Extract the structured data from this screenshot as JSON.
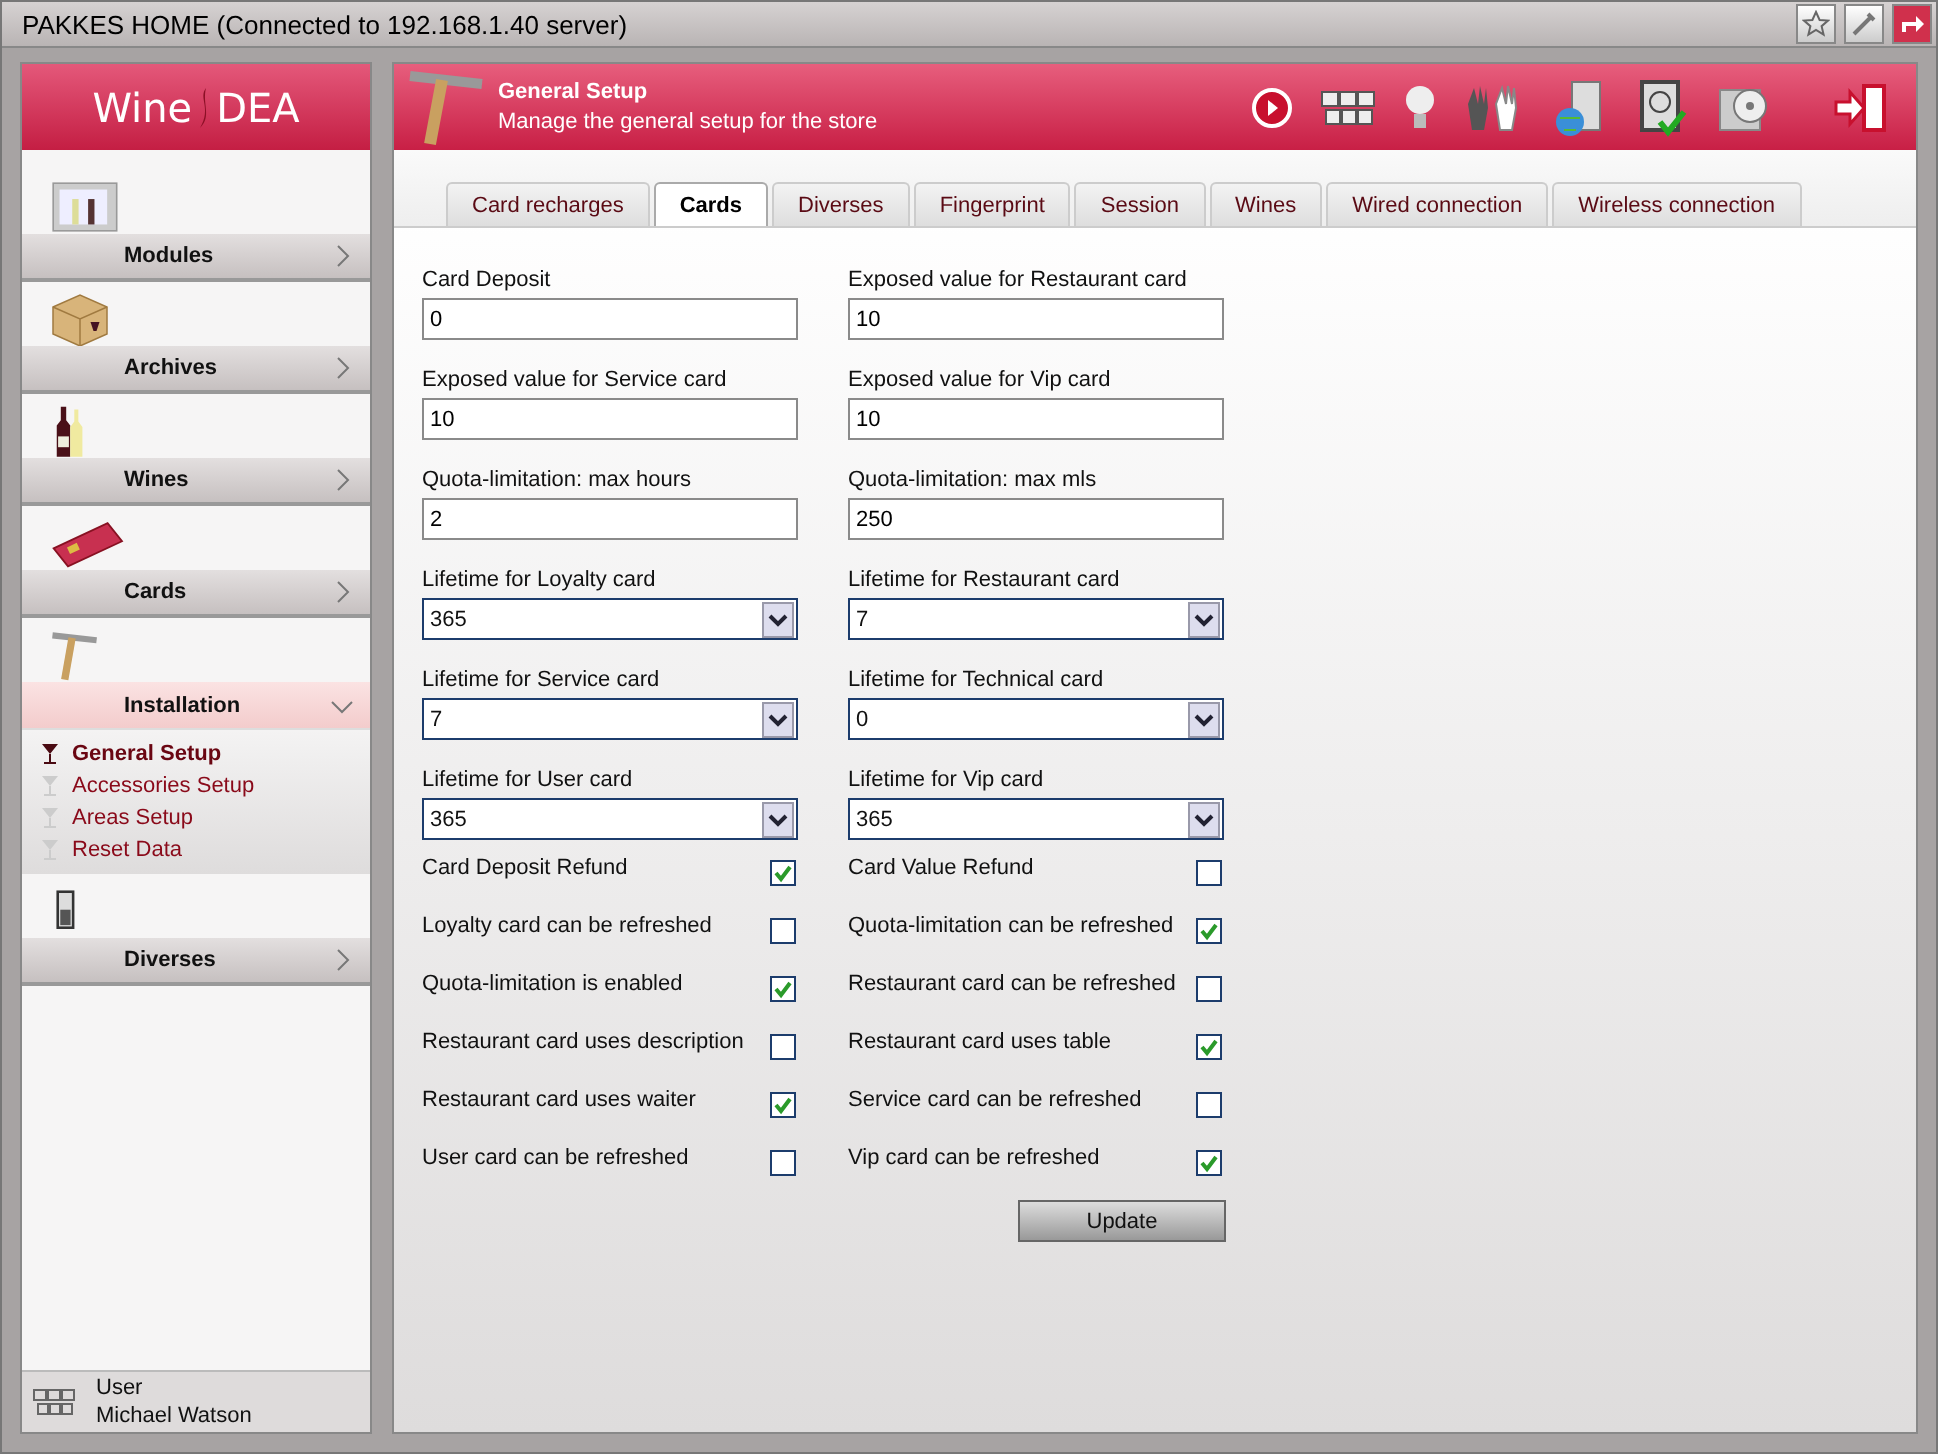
{
  "window": {
    "title": "PAKKES HOME (Connected to 192.168.1.40 server)"
  },
  "logo": {
    "left": "Wine",
    "right": "DEA"
  },
  "sidebar": {
    "items": [
      {
        "label": "Modules",
        "expanded": false
      },
      {
        "label": "Archives",
        "expanded": false
      },
      {
        "label": "Wines",
        "expanded": false
      },
      {
        "label": "Cards",
        "expanded": false
      },
      {
        "label": "Installation",
        "expanded": true,
        "children": [
          {
            "label": "General Setup",
            "selected": true
          },
          {
            "label": "Accessories Setup",
            "selected": false
          },
          {
            "label": "Areas Setup",
            "selected": false
          },
          {
            "label": "Reset Data",
            "selected": false
          }
        ]
      },
      {
        "label": "Diverses",
        "expanded": false
      }
    ]
  },
  "user": {
    "role": "User",
    "name": "Michael Watson"
  },
  "header": {
    "title": "General Setup",
    "subtitle": "Manage the general setup for the store"
  },
  "tabs": [
    {
      "label": "Card recharges",
      "selected": false
    },
    {
      "label": "Cards",
      "selected": true
    },
    {
      "label": "Diverses",
      "selected": false
    },
    {
      "label": "Fingerprint",
      "selected": false
    },
    {
      "label": "Session",
      "selected": false
    },
    {
      "label": "Wines",
      "selected": false
    },
    {
      "label": "Wired connection",
      "selected": false
    },
    {
      "label": "Wireless connection",
      "selected": false
    }
  ],
  "fields": [
    {
      "label": "Card Deposit",
      "kind": "text",
      "value": "0"
    },
    {
      "label": "Exposed value for Restaurant card",
      "kind": "text",
      "value": "10"
    },
    {
      "label": "Exposed value for Service card",
      "kind": "text",
      "value": "10"
    },
    {
      "label": "Exposed value for Vip card",
      "kind": "text",
      "value": "10"
    },
    {
      "label": "Quota-limitation: max hours",
      "kind": "text",
      "value": "2"
    },
    {
      "label": "Quota-limitation: max mls",
      "kind": "text",
      "value": "250"
    },
    {
      "label": "Lifetime for Loyalty card",
      "kind": "select",
      "value": "365"
    },
    {
      "label": "Lifetime for Restaurant card",
      "kind": "select",
      "value": "7"
    },
    {
      "label": "Lifetime for Service card",
      "kind": "select",
      "value": "7"
    },
    {
      "label": "Lifetime for Technical card",
      "kind": "select",
      "value": "0"
    },
    {
      "label": "Lifetime for User card",
      "kind": "select",
      "value": "365"
    },
    {
      "label": "Lifetime for Vip card",
      "kind": "select",
      "value": "365"
    }
  ],
  "checkboxes": [
    {
      "label": "Card Deposit Refund",
      "checked": true
    },
    {
      "label": "Card Value Refund",
      "checked": false
    },
    {
      "label": "Loyalty card can be refreshed",
      "checked": false
    },
    {
      "label": "Quota-limitation can be refreshed",
      "checked": true
    },
    {
      "label": "Quota-limitation is enabled",
      "checked": true
    },
    {
      "label": "Restaurant card can be refreshed",
      "checked": false
    },
    {
      "label": "Restaurant card uses description",
      "checked": false
    },
    {
      "label": "Restaurant card uses table",
      "checked": true
    },
    {
      "label": "Restaurant card uses waiter",
      "checked": true
    },
    {
      "label": "Service card can be refreshed",
      "checked": false
    },
    {
      "label": "User card can be refreshed",
      "checked": false
    },
    {
      "label": "Vip card can be refreshed",
      "checked": true
    }
  ],
  "update_button": "Update"
}
